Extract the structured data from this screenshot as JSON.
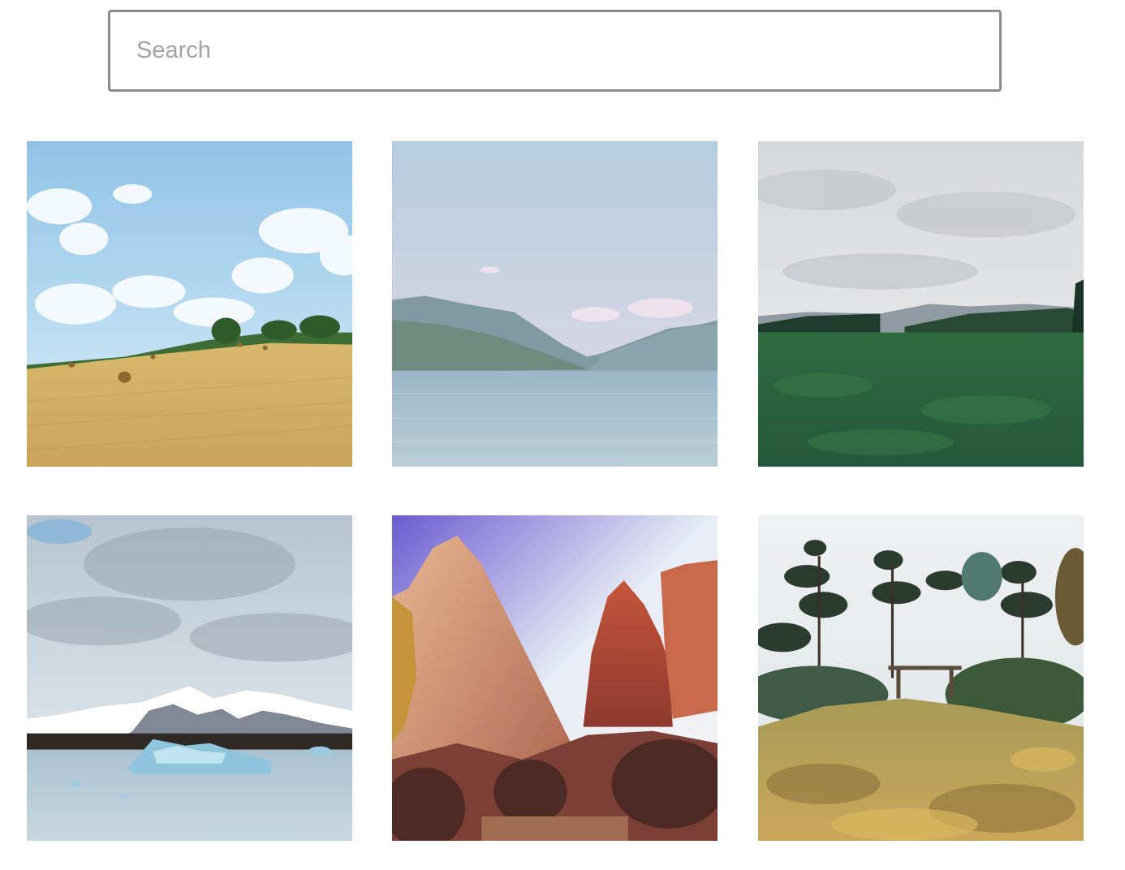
{
  "search": {
    "placeholder": "Search",
    "value": ""
  },
  "gallery": {
    "images": [
      {
        "subject": "hay-field"
      },
      {
        "subject": "mountain-lake"
      },
      {
        "subject": "green-plain"
      },
      {
        "subject": "glacier-lagoon"
      },
      {
        "subject": "red-canyon"
      },
      {
        "subject": "forest-garden"
      }
    ]
  }
}
